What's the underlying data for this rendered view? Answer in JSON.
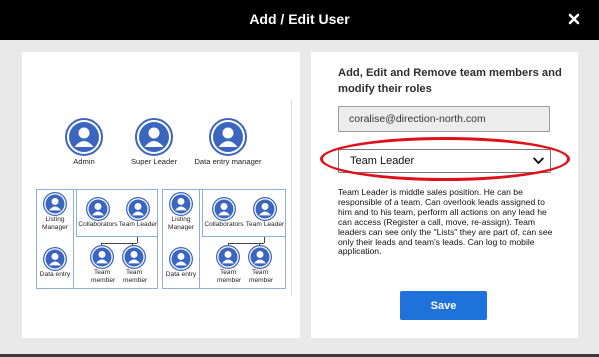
{
  "modal": {
    "title": "Add / Edit User",
    "close_icon": "close-icon"
  },
  "colors": {
    "header_bg": "#000000",
    "accent_blue": "#1f72da",
    "avatar_blue": "#3b66c0",
    "highlight_red": "#e0101a"
  },
  "form": {
    "heading": "Add, Edit and Remove team members and modify their roles",
    "email_value": "coralise@direction-north.com",
    "role_selected": "Team Leader",
    "role_description": "Team Leader is middle sales position. He can be responsible of a team. Can overlook leads assigned to him and to his team, perform all actions on any lead he can access (Register a call, move, re-assign). Team leaders can see only the \"Lists\" they are part of, can see only their leads and team's leads. Can log to mobile application.",
    "save_label": "Save"
  },
  "org_chart": {
    "top_roles": [
      "Admin",
      "Super Leader",
      "Data entry manager"
    ],
    "groups": [
      {
        "listing_manager": "Listing Manager",
        "data_entry": "Data entry",
        "collaborators": "Collaborators",
        "team_leader": "Team Leader",
        "team_member_1": "Team member",
        "team_member_2": "Team member"
      },
      {
        "listing_manager": "Listing Manager",
        "data_entry": "Data entry",
        "collaborators": "Collaborators",
        "team_leader": "Team Leader",
        "team_member_1": "Team member",
        "team_member_2": "Team member"
      }
    ]
  }
}
